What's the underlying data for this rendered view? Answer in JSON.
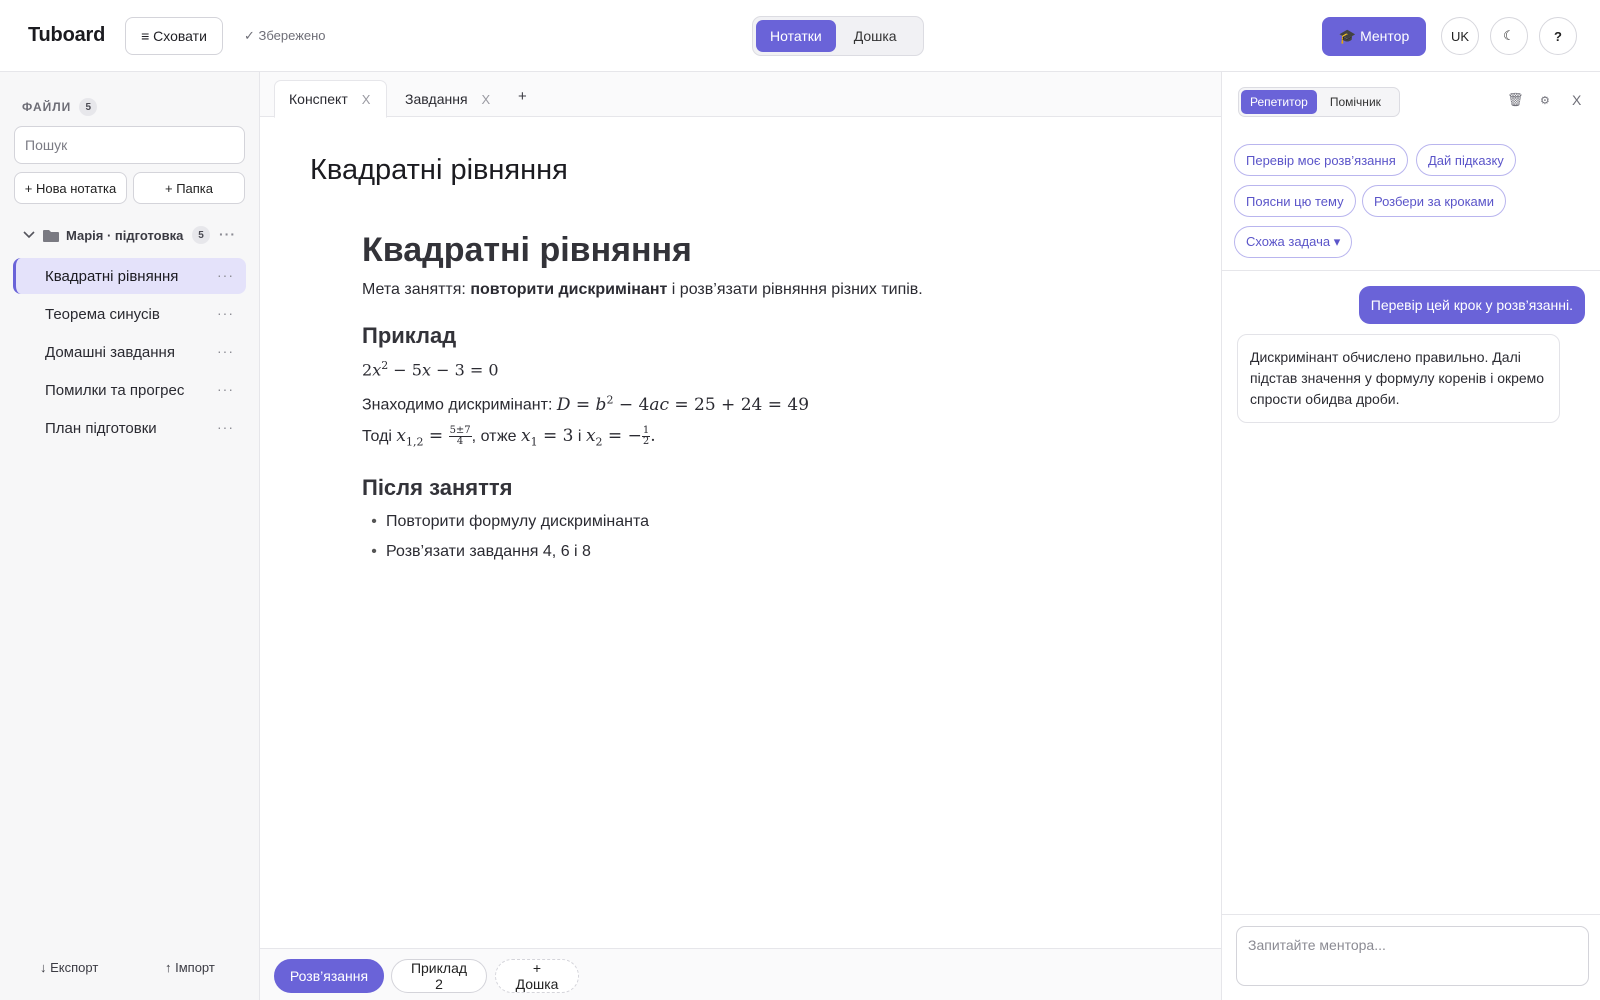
{
  "header": {
    "logo": "Tuboard",
    "hide_label": "≡ Сховати",
    "saved_label": "✓ Збережено",
    "mode_tabs": [
      {
        "label": "Нотатки",
        "active": true
      },
      {
        "label": "Дошка",
        "active": false
      }
    ],
    "mentor_label": "🎓 Ментор",
    "lang_label": "UK",
    "theme_icon": "☾",
    "help_label": "?"
  },
  "sidebar": {
    "files_heading": "ФАЙЛИ",
    "files_count": "5",
    "search_placeholder": "Пошук",
    "new_note_label": "+ Нова нотатка",
    "new_folder_label": "+ Папка",
    "folder": {
      "label": "Марія · підготовка",
      "count": "5",
      "more": "···"
    },
    "items": [
      {
        "label": "Квадратні рівняння",
        "active": true,
        "more": "···"
      },
      {
        "label": "Теорема синусів",
        "active": false,
        "more": "···"
      },
      {
        "label": "Домашні завдання",
        "active": false,
        "more": "···"
      },
      {
        "label": "Помилки та прогрес",
        "active": false,
        "more": "···"
      },
      {
        "label": "План підготовки",
        "active": false,
        "more": "···"
      }
    ],
    "export_label": "↓ Експорт",
    "import_label": "↑ Імпорт"
  },
  "editor": {
    "tabs": [
      {
        "label": "Конспект",
        "close": "X",
        "active": true
      },
      {
        "label": "Завдання",
        "close": "X",
        "active": false
      }
    ],
    "add_tab": "+",
    "doc_title": "Квадратні рівняння",
    "content": {
      "h1": "Квадратні рівняння",
      "goal_prefix": "Мета заняття: ",
      "goal_bold": "повторити дискримінант",
      "goal_suffix": " і розв’язати рівняння різних типів.",
      "example_heading": "Приклад",
      "discriminant_prefix": "Знаходимо дискримінант: ",
      "then_prefix": "Тоді ",
      "then_mid": ", отже ",
      "then_and": " і ",
      "after_heading": "Після заняття",
      "bullets": [
        "Повторити формулу дискримінанта",
        "Розв’язати завдання 4, 6 і 8"
      ]
    },
    "bottom_tabs": [
      {
        "label": "Розв’язання",
        "active": true
      },
      {
        "label": "Приклад 2",
        "active": false
      },
      {
        "label": "+ Дошка",
        "active": false
      }
    ]
  },
  "mentor": {
    "mode_tabs": [
      {
        "label": "Репетитор",
        "active": true
      },
      {
        "label": "Помічник",
        "active": false
      }
    ],
    "trash_icon": "🗑",
    "settings_icon": "⚙",
    "close_label": "X",
    "chips": [
      "Перевір моє розв’язання",
      "Дай підказку",
      "Поясни цю тему",
      "Розбери за кроками",
      "Схожа задача ▾"
    ],
    "messages": [
      {
        "role": "user",
        "text": "Перевір цей крок у розв’язанні."
      },
      {
        "role": "assistant",
        "text": "Дискримінант обчислено правильно. Далі підстав значення у формулу коренів і окремо спрости обидва дроби."
      }
    ],
    "input_placeholder": "Запитайте ментора..."
  },
  "colors": {
    "accent": "#6a63d8",
    "accent_light": "#e4e2fa",
    "border": "#e6e6ea"
  }
}
